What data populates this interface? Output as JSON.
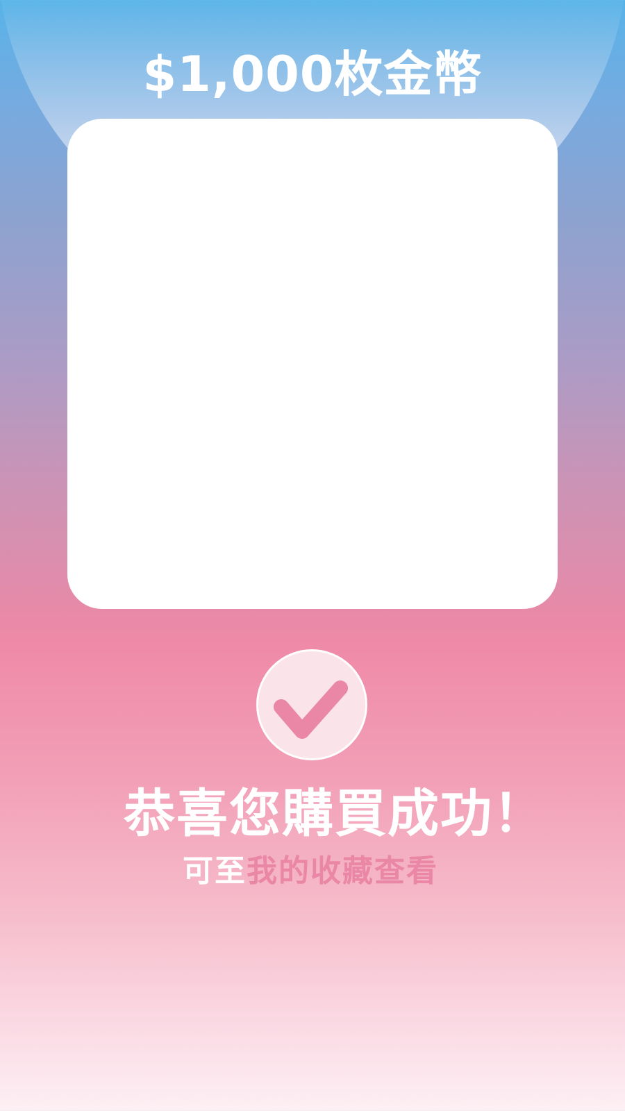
{
  "product": {
    "title": "$1,000枚金幣"
  },
  "result": {
    "icon": "checkmark-icon",
    "message": "恭喜您購買成功！",
    "hint_prefix": "可至",
    "hint_link": "我的收藏查看"
  },
  "colors": {
    "accent_pink": "#ea86a6",
    "gradient_top": "#57b3e8",
    "gradient_mid": "#ef8aa8",
    "gradient_bottom": "#fdf0f4",
    "card": "#ffffff"
  }
}
